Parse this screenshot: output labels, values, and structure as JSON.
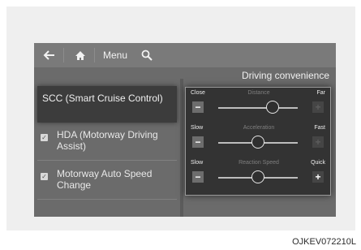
{
  "topbar": {
    "menu_label": "Menu"
  },
  "panel": {
    "title": "Driving convenience"
  },
  "list": {
    "selected_item": "SCC (Smart Cruise Control)",
    "items": [
      {
        "label": "HDA (Motorway Driving Assist)",
        "checked": true
      },
      {
        "label": "Motorway Auto Speed Change",
        "checked": true
      }
    ]
  },
  "controls": [
    {
      "name": "Distance",
      "left": "Close",
      "right": "Far",
      "level": 0.68,
      "plus_enabled": false
    },
    {
      "name": "Acceleration",
      "left": "Slow",
      "right": "Fast",
      "level": 0.5,
      "plus_enabled": false
    },
    {
      "name": "Reaction Speed",
      "left": "Slow",
      "right": "Quick",
      "level": 0.5,
      "plus_enabled": true
    }
  ],
  "caption": "OJKEV072210L",
  "colors": {
    "screen_bg": "#6b6b6b",
    "topbar_bg": "#7a7a7a",
    "panel_bg": "#333333"
  },
  "icons": [
    "back-arrow-icon",
    "home-icon",
    "search-icon",
    "checkbox-icon",
    "minus-icon",
    "plus-icon"
  ]
}
